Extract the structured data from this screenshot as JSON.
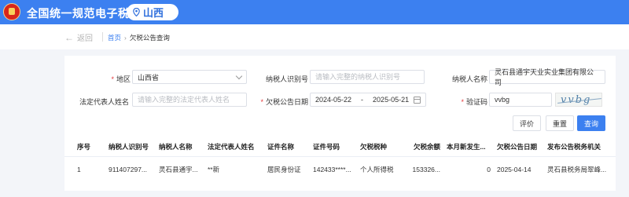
{
  "header": {
    "title": "全国统一规范电子税务局",
    "region": "山西"
  },
  "nav": {
    "back_label": "返回",
    "breadcrumb": [
      "首页",
      "欠税公告查询"
    ],
    "crumb_separator": "›"
  },
  "form": {
    "region_label": "地区",
    "region_value": "山西省",
    "taxpayer_id_label": "纳税人识别号",
    "taxpayer_id_placeholder": "请输入完整的纳税人识别号",
    "taxpayer_name_label": "纳税人名称",
    "taxpayer_name_value": "灵石县通宇天业实业集团有限公司",
    "legal_rep_label": "法定代表人姓名",
    "legal_rep_placeholder": "请输入完整的法定代表人姓名",
    "notice_date_label": "欠税公告日期",
    "date_start": "2024-05-22",
    "date_separator": "-",
    "date_end": "2025-05-21",
    "captcha_label": "验证码",
    "captcha_value": "vvbg",
    "captcha_image_text": "vvbg"
  },
  "buttons": {
    "evaluate": "评价",
    "reset": "重置",
    "query": "查询"
  },
  "table": {
    "columns": [
      "序号",
      "纳税人识别号",
      "纳税人名称",
      "法定代表人姓名",
      "证件名称",
      "证件号码",
      "欠税税种",
      "欠税余额",
      "本月新发生...",
      "欠税公告日期",
      "发布公告税务机关"
    ],
    "rows": [
      [
        "1",
        "911407297...",
        "灵石县通宇...",
        "**新",
        "居民身份证",
        "142433****...",
        "个人所得税",
        "153326...",
        "0",
        "2025-04-14",
        "灵石县税务局翠峰..."
      ]
    ]
  },
  "colors": {
    "brand_blue": "#3c80f0",
    "required_red": "#e4393c"
  }
}
